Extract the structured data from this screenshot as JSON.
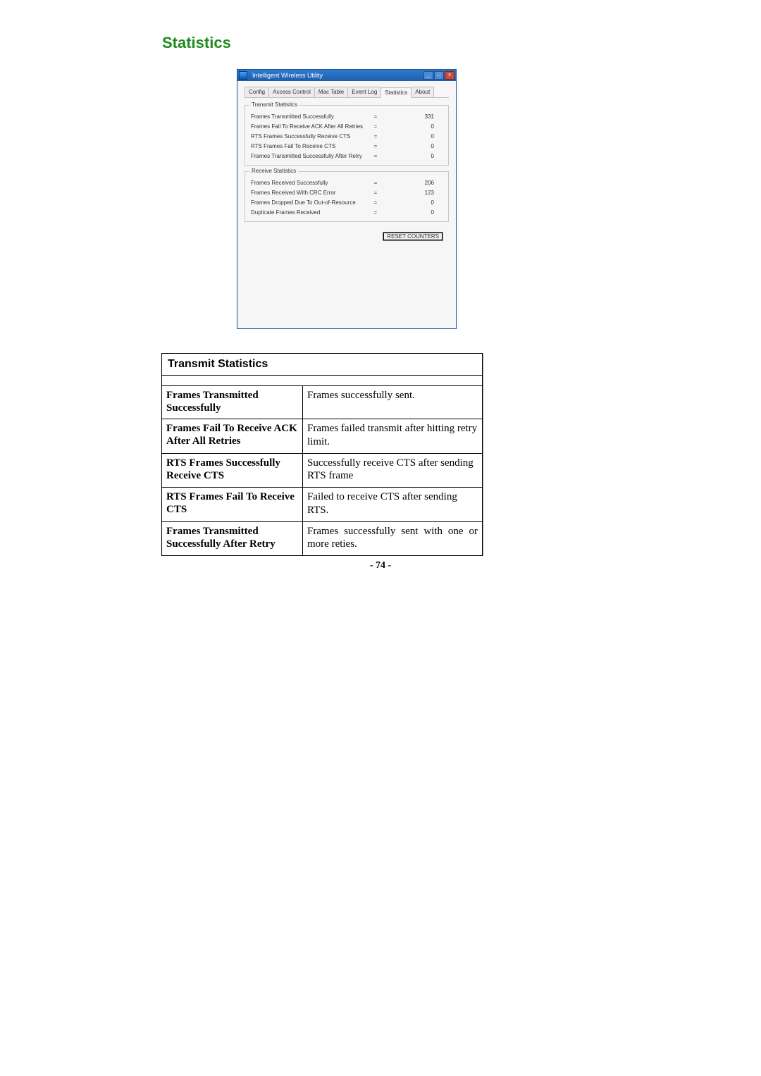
{
  "page": {
    "heading": "Statistics",
    "number": "- 74 -"
  },
  "dialog": {
    "title": "Intelligent Wireless Utility",
    "tabs": [
      "Config",
      "Access Control",
      "Mac Table",
      "Event Log",
      "Statistics",
      "About"
    ],
    "active_tab": "Statistics",
    "transmit": {
      "legend": "Transmit Statistics",
      "rows": [
        {
          "label": "Frames Transmitted Successfully",
          "value": "331"
        },
        {
          "label": "Frames Fail To Receive ACK After All Retries",
          "value": "0"
        },
        {
          "label": "RTS Frames Successfully Receive CTS",
          "value": "0"
        },
        {
          "label": "RTS Frames Fail To Receive CTS",
          "value": "0"
        },
        {
          "label": "Frames Transmitted Successfully After Retry",
          "value": "0"
        }
      ]
    },
    "receive": {
      "legend": "Receive Statistics",
      "rows": [
        {
          "label": "Frames Received Successfully",
          "value": "206"
        },
        {
          "label": "Frames Received With CRC Error",
          "value": "123"
        },
        {
          "label": "Frames Dropped Due To Out-of-Resource",
          "value": "0"
        },
        {
          "label": "Duplicate Frames Received",
          "value": "0"
        }
      ]
    },
    "reset_label": "RESET COUNTERS"
  },
  "definitions": {
    "header": "Transmit Statistics",
    "rows": [
      {
        "term": "Frames Transmitted Successfully",
        "desc": "Frames successfully sent."
      },
      {
        "term": "Frames Fail To Receive ACK After All Retries",
        "desc": "Frames failed transmit after hitting retry limit."
      },
      {
        "term": "RTS Frames Successfully Receive CTS",
        "desc": "Successfully receive CTS after sending RTS frame"
      },
      {
        "term": "RTS Frames Fail To Receive CTS",
        "desc": "Failed to receive CTS after sending RTS."
      },
      {
        "term": "Frames Transmitted Successfully After Retry",
        "desc": "Frames successfully sent with one or more reties."
      }
    ]
  }
}
